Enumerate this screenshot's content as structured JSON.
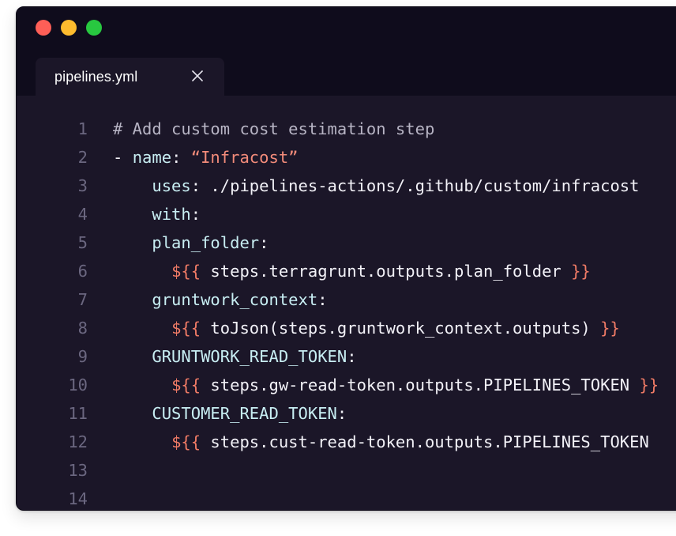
{
  "window": {
    "controls": [
      "close",
      "minimize",
      "maximize"
    ],
    "colors": {
      "close": "#fe5f57",
      "minimize": "#febc2e",
      "maximize": "#28c840"
    }
  },
  "tab": {
    "filename": "pipelines.yml",
    "close_icon": "close-icon"
  },
  "editor": {
    "lines": [
      {
        "num": "1",
        "parts": [
          {
            "t": "# Add custom cost estimation step",
            "c": "comment"
          }
        ]
      },
      {
        "num": "2",
        "parts": [
          {
            "t": "- ",
            "c": "plain"
          },
          {
            "t": "name",
            "c": "key"
          },
          {
            "t": ": ",
            "c": "plain"
          },
          {
            "t": "“Infracost”",
            "c": "str"
          }
        ]
      },
      {
        "num": "3",
        "parts": [
          {
            "t": "    ",
            "c": "plain"
          },
          {
            "t": "uses",
            "c": "key"
          },
          {
            "t": ": ./pipelines-actions/.github/custom/infracost",
            "c": "plain"
          }
        ]
      },
      {
        "num": "4",
        "parts": [
          {
            "t": "    ",
            "c": "plain"
          },
          {
            "t": "with",
            "c": "key"
          },
          {
            "t": ":",
            "c": "plain"
          }
        ]
      },
      {
        "num": "5",
        "parts": [
          {
            "t": "    ",
            "c": "plain"
          },
          {
            "t": "plan_folder",
            "c": "key"
          },
          {
            "t": ":",
            "c": "plain"
          }
        ]
      },
      {
        "num": "6",
        "parts": [
          {
            "t": "      ",
            "c": "plain"
          },
          {
            "t": "${{",
            "c": "orange"
          },
          {
            "t": " steps.terragrunt.outputs.plan_folder ",
            "c": "plain"
          },
          {
            "t": "}}",
            "c": "orange"
          }
        ]
      },
      {
        "num": "7",
        "parts": [
          {
            "t": "    ",
            "c": "plain"
          },
          {
            "t": "gruntwork_context",
            "c": "key"
          },
          {
            "t": ":",
            "c": "plain"
          }
        ]
      },
      {
        "num": "8",
        "parts": [
          {
            "t": "      ",
            "c": "plain"
          },
          {
            "t": "${{",
            "c": "orange"
          },
          {
            "t": " toJson(steps.gruntwork_context.outputs) ",
            "c": "plain"
          },
          {
            "t": "}}",
            "c": "orange"
          }
        ]
      },
      {
        "num": "9",
        "parts": [
          {
            "t": "    ",
            "c": "plain"
          },
          {
            "t": "GRUNTWORK_READ_TOKEN",
            "c": "key"
          },
          {
            "t": ":",
            "c": "plain"
          }
        ]
      },
      {
        "num": "10",
        "parts": [
          {
            "t": "      ",
            "c": "plain"
          },
          {
            "t": "${{",
            "c": "orange"
          },
          {
            "t": " steps.gw-read-token.outputs.PIPELINES_TOKEN ",
            "c": "plain"
          },
          {
            "t": "}}",
            "c": "orange"
          }
        ]
      },
      {
        "num": "11",
        "parts": [
          {
            "t": "    ",
            "c": "plain"
          },
          {
            "t": "CUSTOMER_READ_TOKEN",
            "c": "key"
          },
          {
            "t": ":",
            "c": "plain"
          }
        ]
      },
      {
        "num": "12",
        "parts": [
          {
            "t": "      ",
            "c": "plain"
          },
          {
            "t": "${{",
            "c": "orange"
          },
          {
            "t": " steps.cust-read-token.outputs.PIPELINES_TOKEN",
            "c": "plain"
          }
        ]
      },
      {
        "num": "13",
        "parts": []
      },
      {
        "num": "14",
        "parts": []
      }
    ]
  }
}
